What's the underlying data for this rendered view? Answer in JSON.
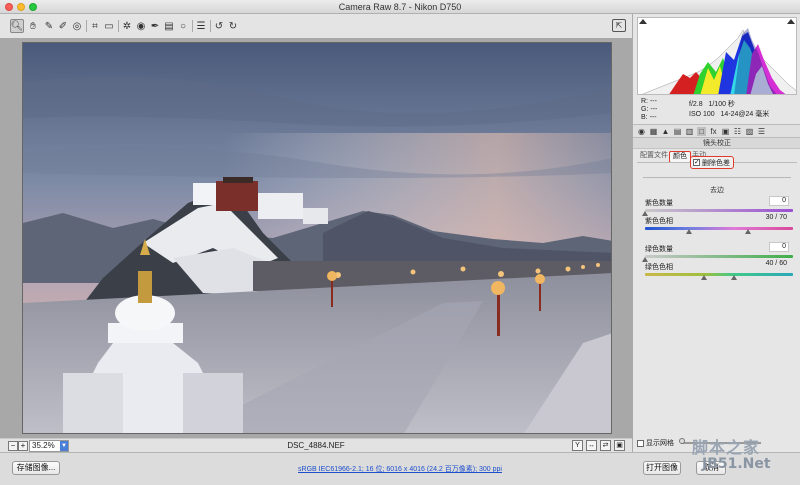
{
  "window": {
    "title": "Camera Raw 8.7 -  Nikon D750"
  },
  "toolbar": {
    "tools": [
      "zoom-icon",
      "hand-icon",
      "white-balance-icon",
      "color-sampler-icon",
      "target-adjust-icon",
      "crop-icon",
      "straighten-icon",
      "spot-removal-icon",
      "red-eye-icon",
      "adjustment-brush-icon",
      "graduated-filter-icon",
      "radial-filter-icon",
      "preferences-icon",
      "rotate-left-icon",
      "rotate-right-icon"
    ]
  },
  "canvas": {
    "zoom_value": "35.2%",
    "filename": "DSC_4884.NEF"
  },
  "histogram": {
    "r_label": "R:",
    "g_label": "G:",
    "b_label": "B:",
    "r_value": "---",
    "g_value": "---",
    "b_value": "---",
    "aperture": "f/2.8",
    "shutter": "1/100 秒",
    "iso": "ISO 100",
    "lens": "14-24@24 毫米"
  },
  "panel": {
    "header": "镜头校正",
    "tabs": [
      "配置文件",
      "颜色",
      "手动"
    ],
    "active_tab_index": 1,
    "remove_ca_label": "删除色差",
    "remove_ca_checked": true,
    "fringe_title": "去边",
    "sliders": [
      {
        "label": "紫色数量",
        "value": "0",
        "boxed": true
      },
      {
        "label": "紫色色相",
        "value": "30 / 70",
        "boxed": false
      },
      {
        "label": "绿色数量",
        "value": "0",
        "boxed": true
      },
      {
        "label": "绿色色相",
        "value": "40 / 60",
        "boxed": false
      }
    ],
    "grid_label": "显示网格"
  },
  "footer": {
    "save_label": "存储图像...",
    "workflow_text": "sRGB IEC61966-2.1; 16 位; 6016 x 4016 (24.2 百万像素); 300 ppi",
    "open_label": "打开图像",
    "cancel_label": "取消"
  },
  "watermark": {
    "line1": "脚本之家",
    "line2": "JB51.Net"
  },
  "colors": {
    "accent_red": "#e03a2a",
    "link_blue": "#1d4fcc"
  }
}
